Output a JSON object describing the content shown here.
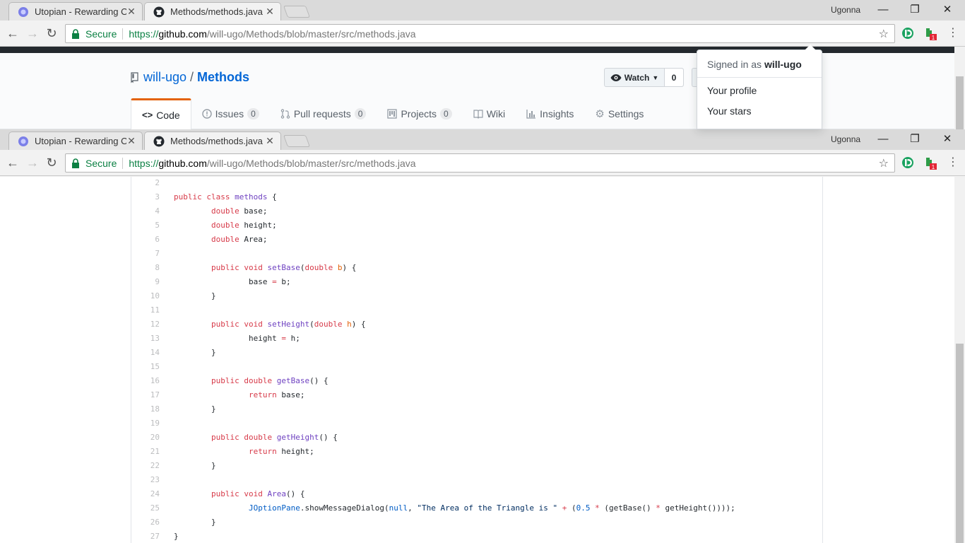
{
  "browser": {
    "tabs": [
      {
        "title": "Utopian - Rewarding Op",
        "close": "✕"
      },
      {
        "title": "Methods/methods.java a",
        "close": "✕"
      }
    ],
    "user": "Ugonna",
    "controls": {
      "minimize": "—",
      "restore": "❐",
      "close": "✕"
    },
    "omnibox": {
      "secure_label": "Secure",
      "scheme": "https://",
      "host": "github.com",
      "path": "/will-ugo/Methods/blob/master/src/methods.java"
    },
    "extension_badge": "1"
  },
  "repo": {
    "owner": "will-ugo",
    "separator": "/",
    "name": "Methods",
    "watch_label": "Watch",
    "watch_count": "0"
  },
  "nav": [
    {
      "label": "Code",
      "icon": "code-icon"
    },
    {
      "label": "Issues",
      "count": "0",
      "icon": "issue-icon"
    },
    {
      "label": "Pull requests",
      "count": "0",
      "icon": "pull-request-icon"
    },
    {
      "label": "Projects",
      "count": "0",
      "icon": "project-icon"
    },
    {
      "label": "Wiki",
      "icon": "book-icon"
    },
    {
      "label": "Insights",
      "icon": "graph-icon"
    },
    {
      "label": "Settings",
      "icon": "gear-icon"
    }
  ],
  "dropdown": {
    "prefix": "Signed in as",
    "username": "will-ugo",
    "items": [
      "Your profile",
      "Your stars"
    ]
  },
  "code": {
    "line_numbers": [
      "2",
      "3",
      "4",
      "5",
      "6",
      "7",
      "8",
      "9",
      "10",
      "11",
      "12",
      "13",
      "14",
      "15",
      "16",
      "17",
      "18",
      "19",
      "20",
      "21",
      "22",
      "23",
      "24",
      "25",
      "26",
      "27"
    ]
  },
  "colors": {
    "keyword": "#d73a49",
    "function": "#6f42c1",
    "param": "#e36209",
    "constant": "#005cc5",
    "string": "#032f62",
    "nav_active_border": "#e36209",
    "link": "#0366d6"
  }
}
